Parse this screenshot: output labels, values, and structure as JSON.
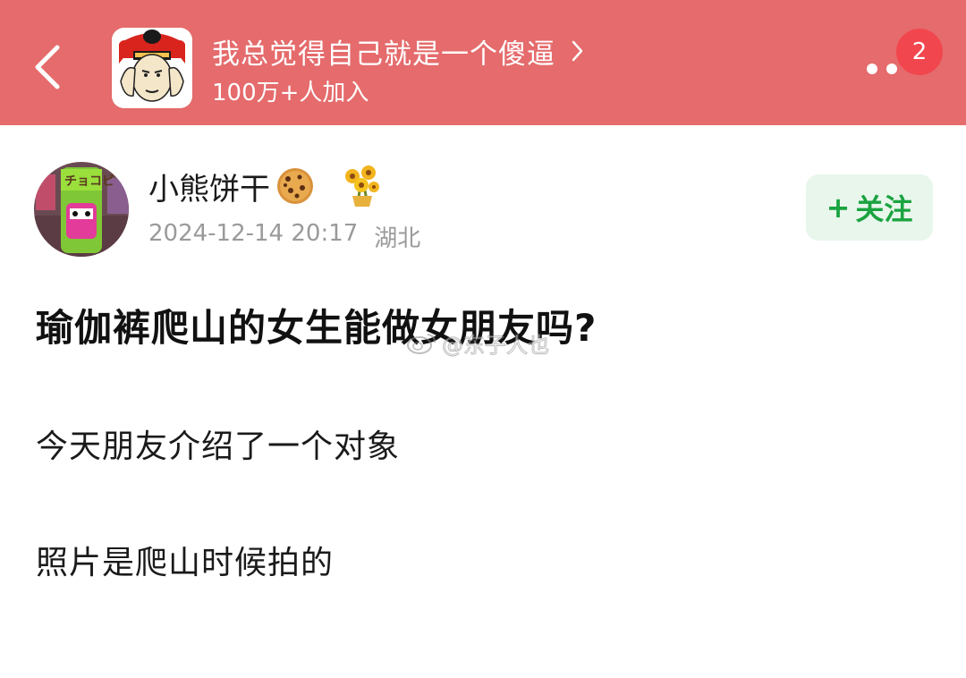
{
  "header": {
    "group_title": "我总觉得自己就是一个傻逼",
    "members": "100万+人加入",
    "badge_count": "2",
    "bg_color": "#e56b6c"
  },
  "author": {
    "name": "小熊饼干",
    "timestamp": "2024-12-14 20:17",
    "location": "湖北"
  },
  "follow": {
    "plus": "+",
    "label": "关注"
  },
  "post": {
    "title": "瑜伽裤爬山的女生能做女朋友吗?",
    "paragraphs": [
      "今天朋友介绍了一个对象",
      "照片是爬山时候拍的"
    ]
  },
  "watermark": {
    "text": "@东子人也"
  },
  "icons": {
    "back": "chevron-left-icon",
    "group_chevron": "chevron-right-icon",
    "more": "more-dots-icon",
    "cookie": "cookie-emoji-icon",
    "sunflower": "sunflower-icon",
    "weibo": "weibo-logo-icon"
  }
}
